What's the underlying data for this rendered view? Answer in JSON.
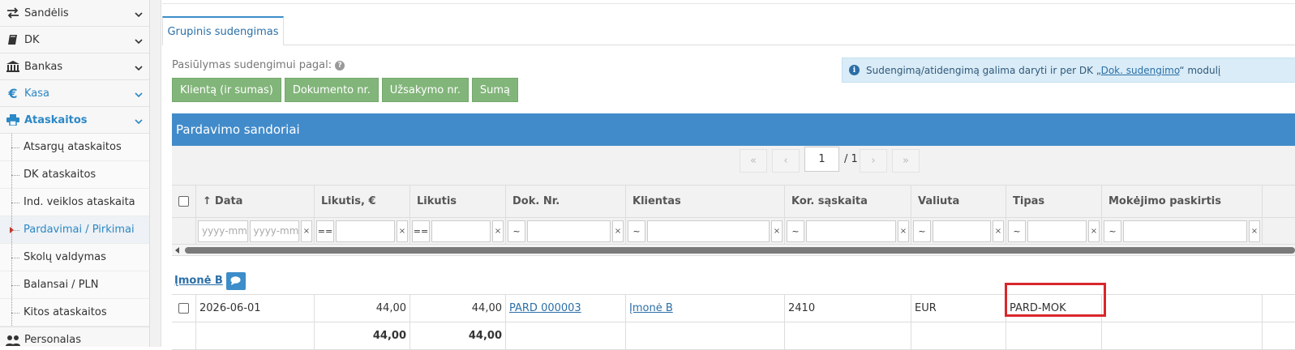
{
  "sidebar": {
    "items": [
      {
        "label": "Sandėlis",
        "icon": "arrows-exchange-icon"
      },
      {
        "label": "DK",
        "icon": "book-icon"
      },
      {
        "label": "Bankas",
        "icon": "bank-icon"
      },
      {
        "label": "Kasa",
        "icon": "euro-icon"
      },
      {
        "label": "Ataskaitos",
        "icon": "printer-icon"
      }
    ],
    "subitems": [
      "Atsargų ataskaitos",
      "DK ataskaitos",
      "Ind. veiklos ataskaita",
      "Pardavimai / Pirkimai",
      "Skolų valdymas",
      "Balansai / PLN",
      "Kitos ataskaitos"
    ],
    "bottom_item": "Personalas"
  },
  "tab": {
    "label": "Grupinis sudengimas"
  },
  "suggest": {
    "label": "Pasiūlymas sudengimui pagal:",
    "buttons": [
      "Klientą (ir sumas)",
      "Dokumento nr.",
      "Užsakymo nr.",
      "Sumą"
    ]
  },
  "info": {
    "prefix": "Sudengimą/atidengimą galima daryti ir per DK „",
    "link": "Dok. sudengimo",
    "suffix": "“ modulį"
  },
  "panel": {
    "title": "Pardavimo sandoriai"
  },
  "pager": {
    "first": "«",
    "prev": "‹",
    "page": "1",
    "total": "/ 1",
    "next": "›",
    "last": "»"
  },
  "grid": {
    "headers": {
      "date": "Data",
      "balance_eur": "Likutis, €",
      "balance": "Likutis",
      "doc_no": "Dok. Nr.",
      "client": "Klientas",
      "account": "Kor. sąskaita",
      "currency": "Valiuta",
      "type": "Tipas",
      "purpose": "Mokėjimo paskirtis"
    },
    "filters": {
      "date_placeholder": "yyyy-mm",
      "eq_op": "==",
      "like_op": "~",
      "clear": "×"
    },
    "group": {
      "name": "Įmonė B"
    },
    "row": {
      "date": "2026-06-01",
      "balance_eur": "44,00",
      "balance": "44,00",
      "doc_no": "PARD 000003",
      "client": "Įmonė B",
      "account": "2410",
      "currency": "EUR",
      "type": "PARD-MOK",
      "purpose": ""
    },
    "totals": {
      "balance_eur": "44,00",
      "balance": "44,00"
    }
  },
  "colors": {
    "accent": "#428bca",
    "green_button": "#82b57a",
    "highlight": "#d9262c"
  }
}
